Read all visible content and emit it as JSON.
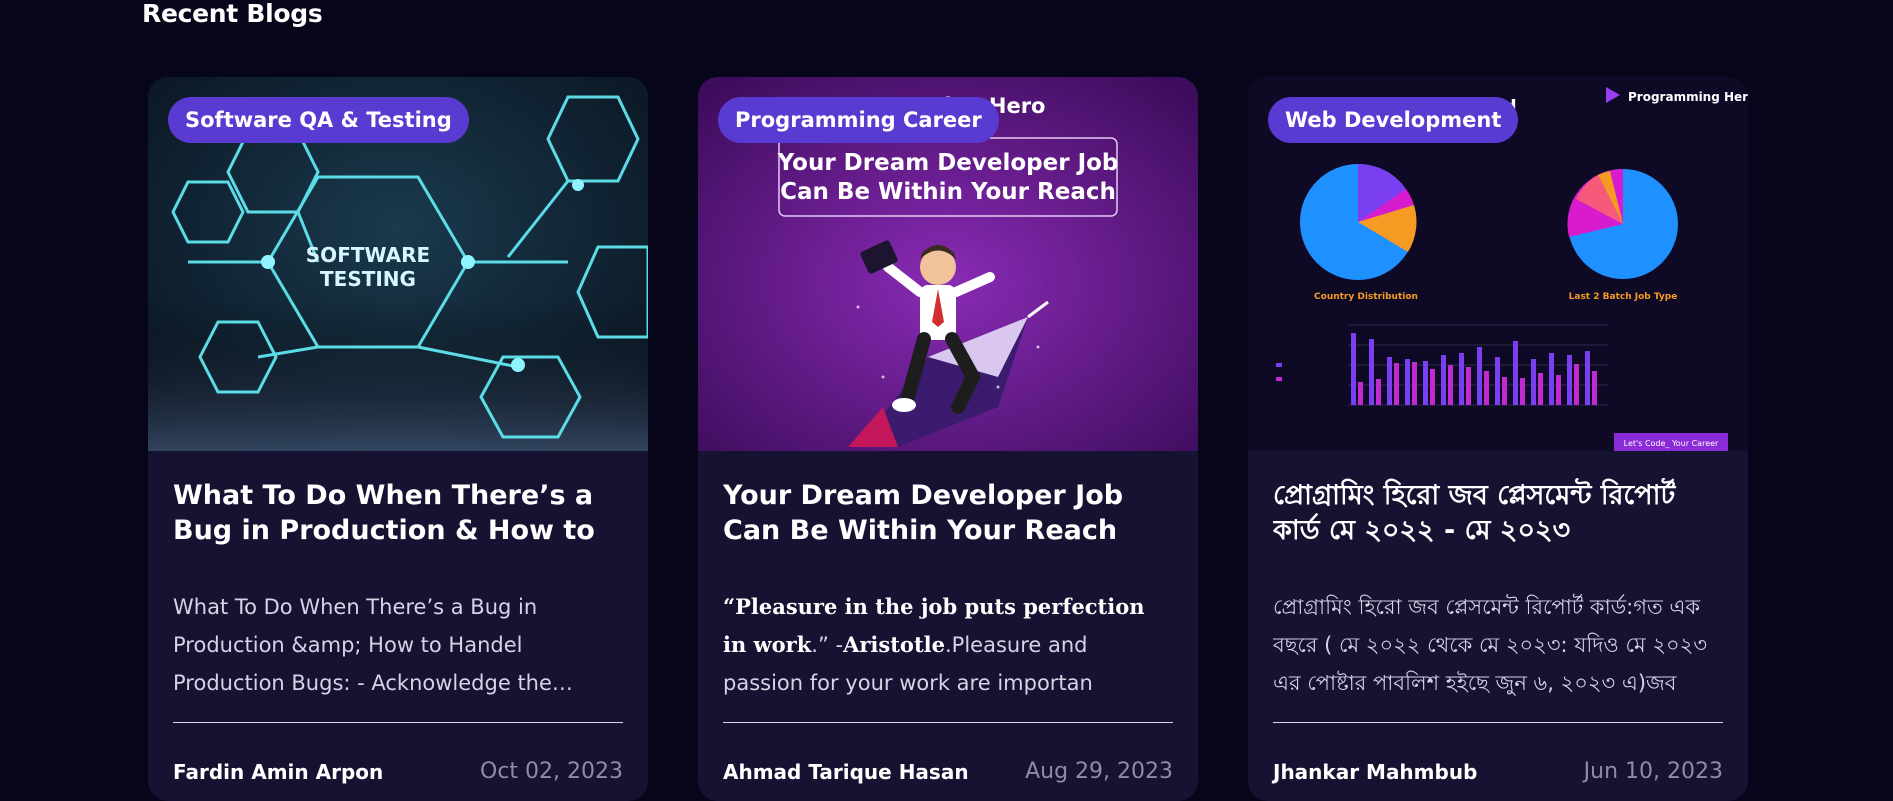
{
  "section": {
    "title": "Recent Blogs"
  },
  "cards": [
    {
      "category": "Software QA & Testing",
      "image_text": [
        "SOFTWARE",
        "TESTING"
      ],
      "title": "What To Do When There’s a Bug in Production & How to Handel…",
      "excerpt": "What To Do When There’s a Bug in Production &amp; How to Handel Production Bugs: - Acknowledge the…",
      "author": "Fardin Amin Arpon",
      "date": "Oct 02, 2023"
    },
    {
      "category": "Programming Career",
      "image_brand": "ming Hero",
      "image_headline_1": "Your Dream Developer Job",
      "image_headline_2": "Can Be Within Your Reach",
      "title": "Your Dream Developer Job Can Be Within Your Reach",
      "excerpt_quote": "“Pleasure in the job puts perfection in work",
      "excerpt_mid": ".” -",
      "excerpt_author": "Aristotle",
      "excerpt_rest": ".Pleasure and passion for your work are importan",
      "author": "Ahmad Tarique Hasan",
      "date": "Aug 29, 2023"
    },
    {
      "category": "Web Development",
      "image_heading": "t Card",
      "image_brand": "Programming Hero",
      "image_chart1_label": "Country Distribution",
      "image_chart2_label": "Last 2 Batch Job Type",
      "image_footer": "Let's Code_ Your Career",
      "title": "প্রোগ্রামিং হিরো জব প্লেসমেন্ট রিপোর্ট কার্ড মে ২০২২ - মে ২০২৩",
      "excerpt": "প্রোগ্রামিং হিরো জব প্লেসমেন্ট রিপোর্ট কার্ড:গত এক বছরে ( মে ২০২২ থেকে মে ২০২৩: যদিও মে ২০২৩ এর পোষ্টার পাবলিশ হইছে জুন ৬, ২০২৩ এ)জব পোষ্টার পাবলিশ কর",
      "author": "Jhankar Mahmbub",
      "date": "Jun 10, 2023"
    }
  ],
  "colors": {
    "background": "#06051a",
    "card": "#161232",
    "badge": "#5a3bd1",
    "accent_purple": "#7a1fa0",
    "chart_blue": "#1e90ff",
    "chart_magenta": "#d81bcf"
  }
}
